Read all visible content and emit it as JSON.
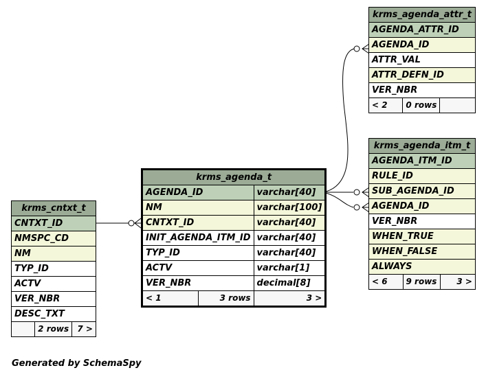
{
  "tables": {
    "agenda_attr": {
      "name": "krms_agenda_attr_t",
      "columns": [
        "AGENDA_ATTR_ID",
        "AGENDA_ID",
        "ATTR_VAL",
        "ATTR_DEFN_ID",
        "VER_NBR"
      ],
      "footer": {
        "parents": "< 2",
        "rows": "0 rows",
        "children": ""
      }
    },
    "agenda_itm": {
      "name": "krms_agenda_itm_t",
      "columns": [
        "AGENDA_ITM_ID",
        "RULE_ID",
        "SUB_AGENDA_ID",
        "AGENDA_ID",
        "VER_NBR",
        "WHEN_TRUE",
        "WHEN_FALSE",
        "ALWAYS"
      ],
      "footer": {
        "parents": "< 6",
        "rows": "9 rows",
        "children": "3 >"
      }
    },
    "agenda": {
      "name": "krms_agenda_t",
      "columns": [
        "AGENDA_ID",
        "NM",
        "CNTXT_ID",
        "INIT_AGENDA_ITM_ID",
        "TYP_ID",
        "ACTV",
        "VER_NBR"
      ],
      "types": [
        "varchar[40]",
        "varchar[100]",
        "varchar[40]",
        "varchar[40]",
        "varchar[40]",
        "varchar[1]",
        "decimal[8]"
      ],
      "footer": {
        "parents": "< 1",
        "rows": "3 rows",
        "children": "3 >"
      }
    },
    "cntxt": {
      "name": "krms_cntxt_t",
      "columns": [
        "CNTXT_ID",
        "NMSPC_CD",
        "NM",
        "TYP_ID",
        "ACTV",
        "VER_NBR",
        "DESC_TXT"
      ],
      "footer": {
        "parents": "",
        "rows": "2 rows",
        "children": "7 >"
      }
    }
  },
  "footer_text": "Generated by SchemaSpy",
  "colors": {
    "title": "#9bab96",
    "primary_key": "#bed1b8",
    "foreign_key": "#f4f7da",
    "plain": "#ffffff",
    "footer": "#f7f7f7"
  }
}
